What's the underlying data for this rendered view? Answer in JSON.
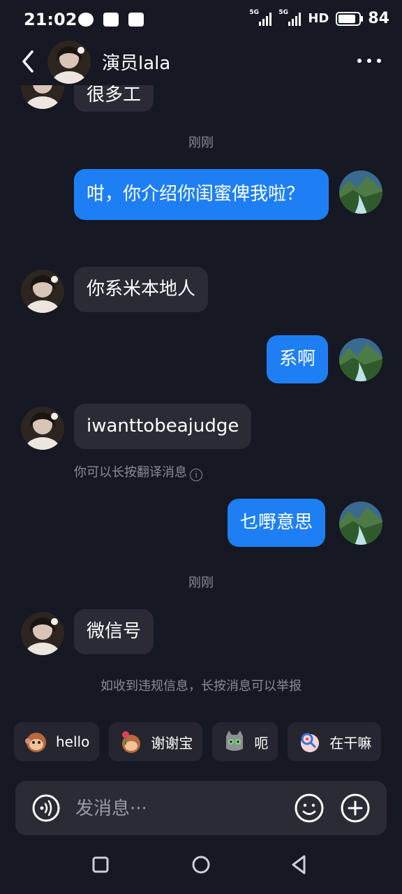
{
  "status": {
    "time": "21:02",
    "signal1": "5G",
    "signal2": "5G",
    "network": "HD",
    "battery": "84"
  },
  "header": {
    "name": "演员lala"
  },
  "messages": {
    "partial": "很多工",
    "ts1": "刚刚",
    "m1": "咁，你介绍你闺蜜俾我啦？",
    "m2": "你系米本地人",
    "m3": "系啊",
    "m4": "iwanttobeajudge",
    "translate_hint": "你可以长按翻译消息",
    "m5": "乜嘢意思",
    "ts2": "刚刚",
    "m6": "微信号",
    "report_hint": "如收到违规信息，长按消息可以举报"
  },
  "quick_replies": [
    "hello",
    "谢谢宝",
    "呃",
    "在干嘛"
  ],
  "input": {
    "placeholder": "发消息···"
  },
  "colors": {
    "background": "#161823",
    "outgoing_bubble": "#1e7ff5",
    "incoming_bubble": "#2a2b35"
  }
}
